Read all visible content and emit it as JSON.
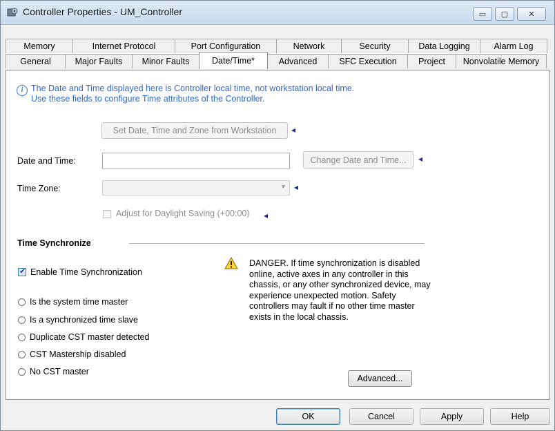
{
  "window": {
    "title": "Controller Properties - UM_Controller",
    "controls": {
      "minimize": "▭",
      "maximize": "▢",
      "close": "✕"
    }
  },
  "tabs": {
    "row1": [
      "Memory",
      "Internet Protocol",
      "Port Configuration",
      "Network",
      "Security",
      "Data Logging",
      "Alarm Log"
    ],
    "row2": [
      "General",
      "Major Faults",
      "Minor Faults",
      "Date/Time*",
      "Advanced",
      "SFC Execution",
      "Project",
      "Nonvolatile Memory"
    ],
    "active": "Date/Time*"
  },
  "date_time": {
    "info_line1": "The Date and Time displayed here is Controller local time, not workstation local time.",
    "info_line2": "Use these fields to configure Time attributes of the Controller.",
    "set_from_workstation_button": "Set Date, Time and Zone from Workstation",
    "date_time_label": "Date and Time:",
    "date_time_value": "",
    "change_button": "Change Date and Time...",
    "time_zone_label": "Time Zone:",
    "time_zone_value": "",
    "daylight_label": "Adjust for Daylight Saving (+00:00)",
    "arrow_glyph": "◂"
  },
  "time_sync": {
    "section_title": "Time Synchronize",
    "enable_label": "Enable Time Synchronization",
    "enable_checked": true,
    "radios": [
      "Is the system time master",
      "Is a synchronized time slave",
      "Duplicate CST master detected",
      "CST Mastership disabled",
      "No CST master"
    ],
    "warning": "DANGER. If time synchronization is disabled online, active axes in any controller in this chassis, or any other synchronized device, may experience unexpected motion.  Safety controllers may fault if no other time master exists in the local chassis.",
    "advanced_button": "Advanced..."
  },
  "footer": {
    "ok": "OK",
    "cancel": "Cancel",
    "apply": "Apply",
    "help": "Help"
  }
}
